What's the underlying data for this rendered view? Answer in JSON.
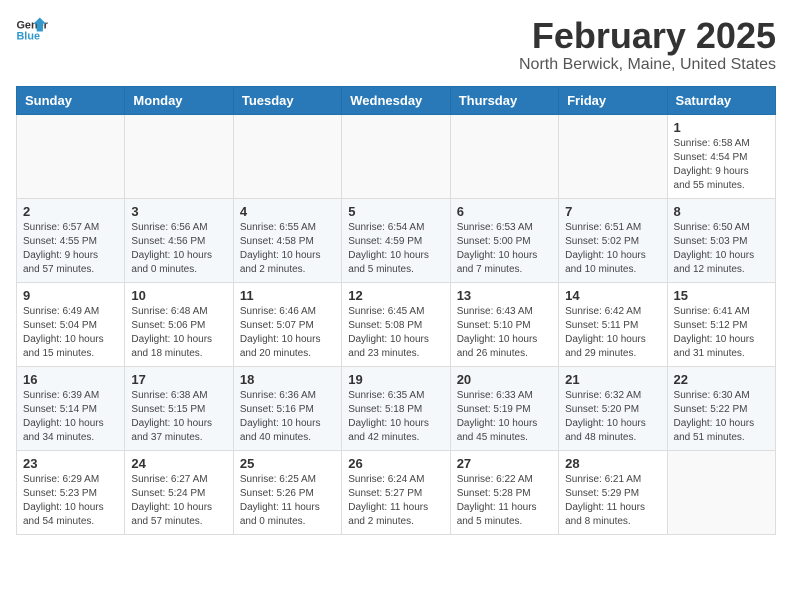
{
  "header": {
    "logo_line1": "General",
    "logo_line2": "Blue",
    "title": "February 2025",
    "subtitle": "North Berwick, Maine, United States"
  },
  "days_of_week": [
    "Sunday",
    "Monday",
    "Tuesday",
    "Wednesday",
    "Thursday",
    "Friday",
    "Saturday"
  ],
  "weeks": [
    [
      {
        "day": "",
        "info": ""
      },
      {
        "day": "",
        "info": ""
      },
      {
        "day": "",
        "info": ""
      },
      {
        "day": "",
        "info": ""
      },
      {
        "day": "",
        "info": ""
      },
      {
        "day": "",
        "info": ""
      },
      {
        "day": "1",
        "info": "Sunrise: 6:58 AM\nSunset: 4:54 PM\nDaylight: 9 hours\nand 55 minutes."
      }
    ],
    [
      {
        "day": "2",
        "info": "Sunrise: 6:57 AM\nSunset: 4:55 PM\nDaylight: 9 hours\nand 57 minutes."
      },
      {
        "day": "3",
        "info": "Sunrise: 6:56 AM\nSunset: 4:56 PM\nDaylight: 10 hours\nand 0 minutes."
      },
      {
        "day": "4",
        "info": "Sunrise: 6:55 AM\nSunset: 4:58 PM\nDaylight: 10 hours\nand 2 minutes."
      },
      {
        "day": "5",
        "info": "Sunrise: 6:54 AM\nSunset: 4:59 PM\nDaylight: 10 hours\nand 5 minutes."
      },
      {
        "day": "6",
        "info": "Sunrise: 6:53 AM\nSunset: 5:00 PM\nDaylight: 10 hours\nand 7 minutes."
      },
      {
        "day": "7",
        "info": "Sunrise: 6:51 AM\nSunset: 5:02 PM\nDaylight: 10 hours\nand 10 minutes."
      },
      {
        "day": "8",
        "info": "Sunrise: 6:50 AM\nSunset: 5:03 PM\nDaylight: 10 hours\nand 12 minutes."
      }
    ],
    [
      {
        "day": "9",
        "info": "Sunrise: 6:49 AM\nSunset: 5:04 PM\nDaylight: 10 hours\nand 15 minutes."
      },
      {
        "day": "10",
        "info": "Sunrise: 6:48 AM\nSunset: 5:06 PM\nDaylight: 10 hours\nand 18 minutes."
      },
      {
        "day": "11",
        "info": "Sunrise: 6:46 AM\nSunset: 5:07 PM\nDaylight: 10 hours\nand 20 minutes."
      },
      {
        "day": "12",
        "info": "Sunrise: 6:45 AM\nSunset: 5:08 PM\nDaylight: 10 hours\nand 23 minutes."
      },
      {
        "day": "13",
        "info": "Sunrise: 6:43 AM\nSunset: 5:10 PM\nDaylight: 10 hours\nand 26 minutes."
      },
      {
        "day": "14",
        "info": "Sunrise: 6:42 AM\nSunset: 5:11 PM\nDaylight: 10 hours\nand 29 minutes."
      },
      {
        "day": "15",
        "info": "Sunrise: 6:41 AM\nSunset: 5:12 PM\nDaylight: 10 hours\nand 31 minutes."
      }
    ],
    [
      {
        "day": "16",
        "info": "Sunrise: 6:39 AM\nSunset: 5:14 PM\nDaylight: 10 hours\nand 34 minutes."
      },
      {
        "day": "17",
        "info": "Sunrise: 6:38 AM\nSunset: 5:15 PM\nDaylight: 10 hours\nand 37 minutes."
      },
      {
        "day": "18",
        "info": "Sunrise: 6:36 AM\nSunset: 5:16 PM\nDaylight: 10 hours\nand 40 minutes."
      },
      {
        "day": "19",
        "info": "Sunrise: 6:35 AM\nSunset: 5:18 PM\nDaylight: 10 hours\nand 42 minutes."
      },
      {
        "day": "20",
        "info": "Sunrise: 6:33 AM\nSunset: 5:19 PM\nDaylight: 10 hours\nand 45 minutes."
      },
      {
        "day": "21",
        "info": "Sunrise: 6:32 AM\nSunset: 5:20 PM\nDaylight: 10 hours\nand 48 minutes."
      },
      {
        "day": "22",
        "info": "Sunrise: 6:30 AM\nSunset: 5:22 PM\nDaylight: 10 hours\nand 51 minutes."
      }
    ],
    [
      {
        "day": "23",
        "info": "Sunrise: 6:29 AM\nSunset: 5:23 PM\nDaylight: 10 hours\nand 54 minutes."
      },
      {
        "day": "24",
        "info": "Sunrise: 6:27 AM\nSunset: 5:24 PM\nDaylight: 10 hours\nand 57 minutes."
      },
      {
        "day": "25",
        "info": "Sunrise: 6:25 AM\nSunset: 5:26 PM\nDaylight: 11 hours\nand 0 minutes."
      },
      {
        "day": "26",
        "info": "Sunrise: 6:24 AM\nSunset: 5:27 PM\nDaylight: 11 hours\nand 2 minutes."
      },
      {
        "day": "27",
        "info": "Sunrise: 6:22 AM\nSunset: 5:28 PM\nDaylight: 11 hours\nand 5 minutes."
      },
      {
        "day": "28",
        "info": "Sunrise: 6:21 AM\nSunset: 5:29 PM\nDaylight: 11 hours\nand 8 minutes."
      },
      {
        "day": "",
        "info": ""
      }
    ]
  ]
}
